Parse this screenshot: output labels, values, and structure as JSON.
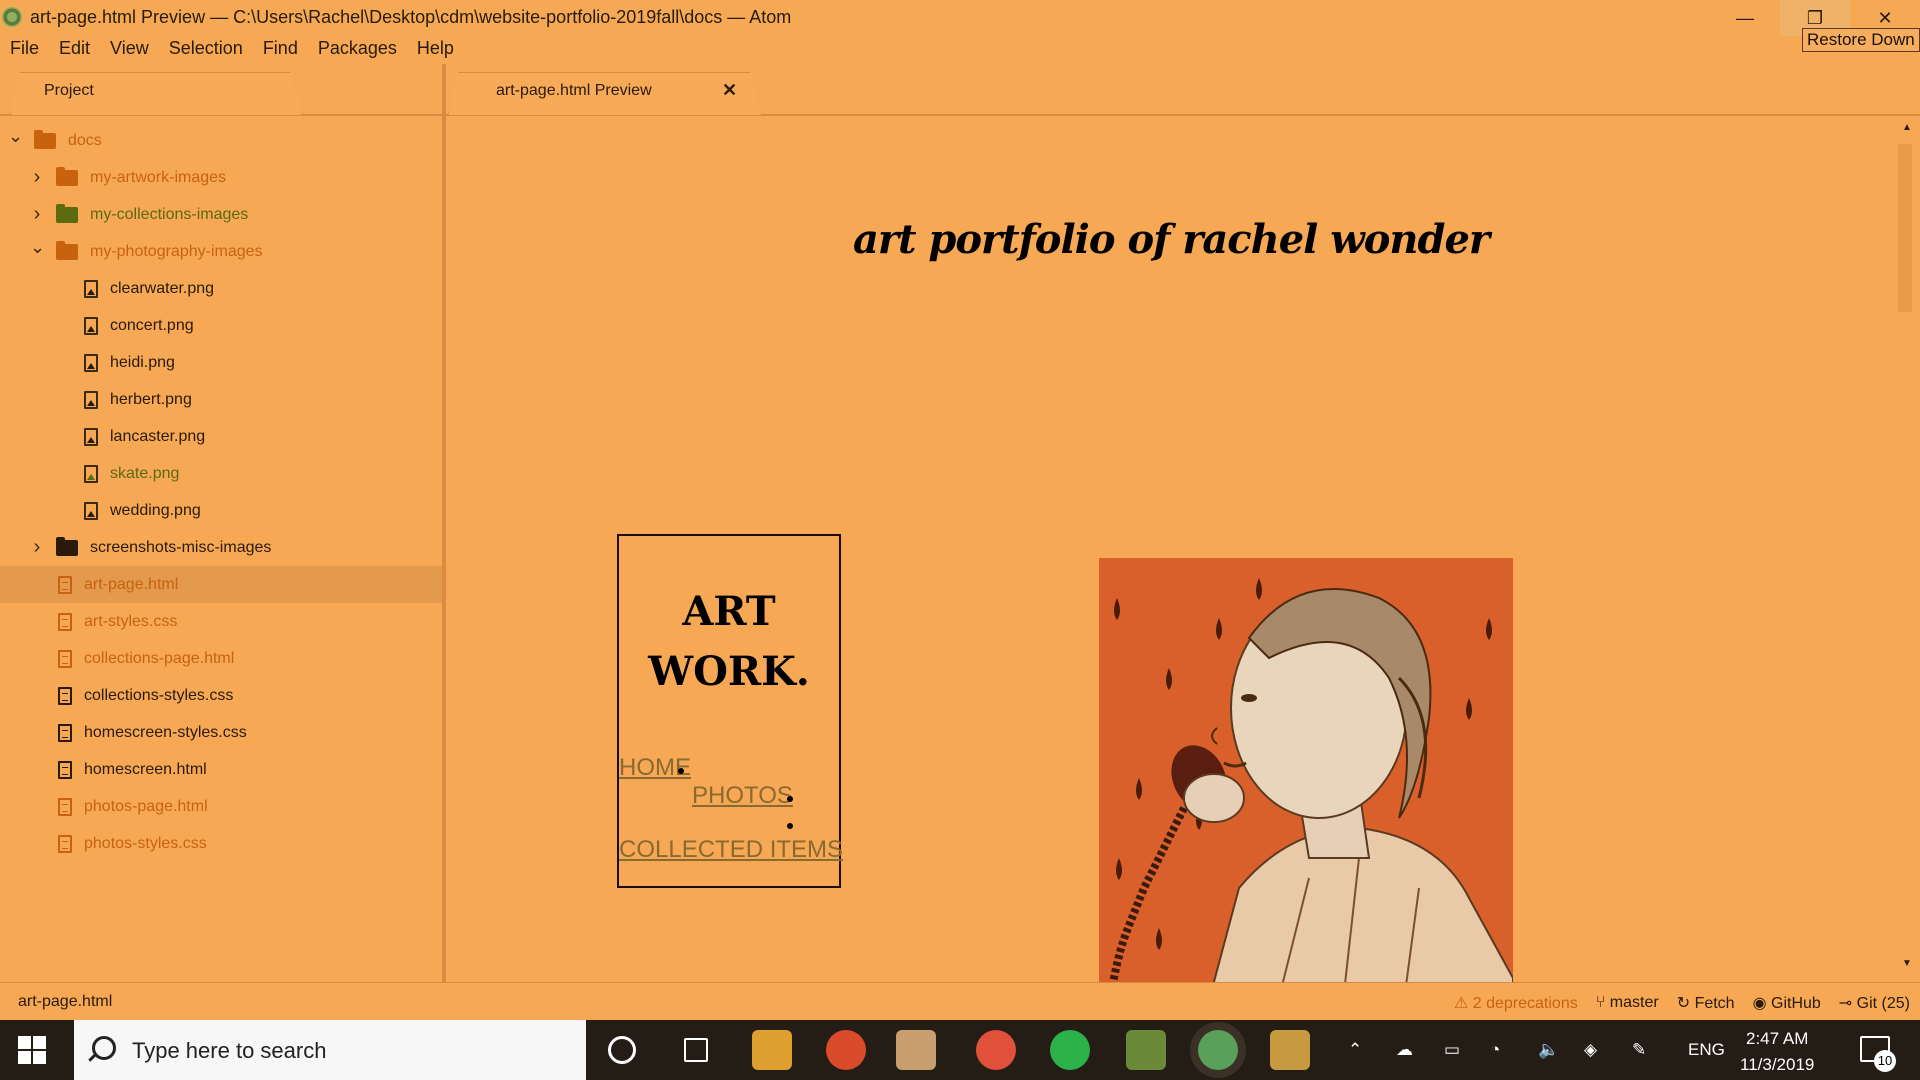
{
  "window": {
    "title": "art-page.html Preview — C:\\Users\\Rachel\\Desktop\\cdm\\website-portfolio-2019fall\\docs — Atom",
    "minimize_icon": "—",
    "restore_icon": "❐",
    "close_icon": "✕",
    "tooltip": "Restore Down"
  },
  "menu": [
    "File",
    "Edit",
    "View",
    "Selection",
    "Find",
    "Packages",
    "Help"
  ],
  "project": {
    "tab_label": "Project",
    "tree": [
      {
        "label": "docs",
        "type": "folder",
        "arrow": "v",
        "color": "#c8620f",
        "icon_color": "#c8620f"
      },
      {
        "label": "my-artwork-images",
        "type": "folder",
        "arrow": ">",
        "color": "#c8620f",
        "icon_color": "#c8620f"
      },
      {
        "label": "my-collections-images",
        "type": "folder",
        "arrow": ">",
        "color": "#5c6a10",
        "icon_color": "#5c6a10"
      },
      {
        "label": "my-photography-images",
        "type": "folder",
        "arrow": "v",
        "color": "#c8620f",
        "icon_color": "#c8620f"
      },
      {
        "label": "clearwater.png",
        "type": "image",
        "color": "#2a1a0a"
      },
      {
        "label": "concert.png",
        "type": "image",
        "color": "#2a1a0a"
      },
      {
        "label": "heidi.png",
        "type": "image",
        "color": "#2a1a0a"
      },
      {
        "label": "herbert.png",
        "type": "image",
        "color": "#2a1a0a"
      },
      {
        "label": "lancaster.png",
        "type": "image",
        "color": "#2a1a0a"
      },
      {
        "label": "skate.png",
        "type": "image",
        "color": "#5c6a10"
      },
      {
        "label": "wedding.png",
        "type": "image",
        "color": "#2a1a0a"
      },
      {
        "label": "screenshots-misc-images",
        "type": "folder",
        "arrow": ">",
        "color": "#2a1a0a",
        "icon_color": "#2a1a0a"
      },
      {
        "label": "art-page.html",
        "type": "doc",
        "color": "#c8620f",
        "selected": true
      },
      {
        "label": "art-styles.css",
        "type": "doc",
        "color": "#c8620f"
      },
      {
        "label": "collections-page.html",
        "type": "doc",
        "color": "#c8620f"
      },
      {
        "label": "collections-styles.css",
        "type": "doc",
        "color": "#2a1a0a"
      },
      {
        "label": "homescreen-styles.css",
        "type": "doc",
        "color": "#2a1a0a"
      },
      {
        "label": "homescreen.html",
        "type": "doc",
        "color": "#2a1a0a"
      },
      {
        "label": "photos-page.html",
        "type": "doc",
        "color": "#c8620f"
      },
      {
        "label": "photos-styles.css",
        "type": "doc",
        "color": "#c8620f"
      }
    ]
  },
  "editor": {
    "tab_label": "art-page.html Preview",
    "tab_close": "✕",
    "preview": {
      "heading": "art portfolio of rachel wonder",
      "nav_title_line1": "ART",
      "nav_title_line2": "WORK.",
      "links": {
        "home": "HOME",
        "photos": "PHOTOS",
        "collected": "COLLECTED ITEMS"
      }
    }
  },
  "status": {
    "file": "art-page.html",
    "deprecations": "2 deprecations",
    "branch": "master",
    "fetch": "Fetch",
    "github": "GitHub",
    "git": "Git (25)"
  },
  "taskbar": {
    "search_placeholder": "Type here to search",
    "language": "ENG",
    "time": "2:47 AM",
    "date": "11/3/2019",
    "notifications": "10",
    "apps": [
      {
        "name": "cortana-icon",
        "color": "#241d16"
      },
      {
        "name": "task-view-icon",
        "color": "#241d16"
      },
      {
        "name": "file-explorer-icon",
        "color": "#e0a030"
      },
      {
        "name": "chrome-icon",
        "color": "#d94b2b"
      },
      {
        "name": "notepad-icon",
        "color": "#c8a070"
      },
      {
        "name": "itunes-icon",
        "color": "#e0503a"
      },
      {
        "name": "spotify-icon",
        "color": "#2db14b"
      },
      {
        "name": "minecraft-icon",
        "color": "#6a8a3a"
      },
      {
        "name": "atom-icon",
        "color": "#5aa05a"
      },
      {
        "name": "paint-icon",
        "color": "#c89a40"
      }
    ]
  }
}
